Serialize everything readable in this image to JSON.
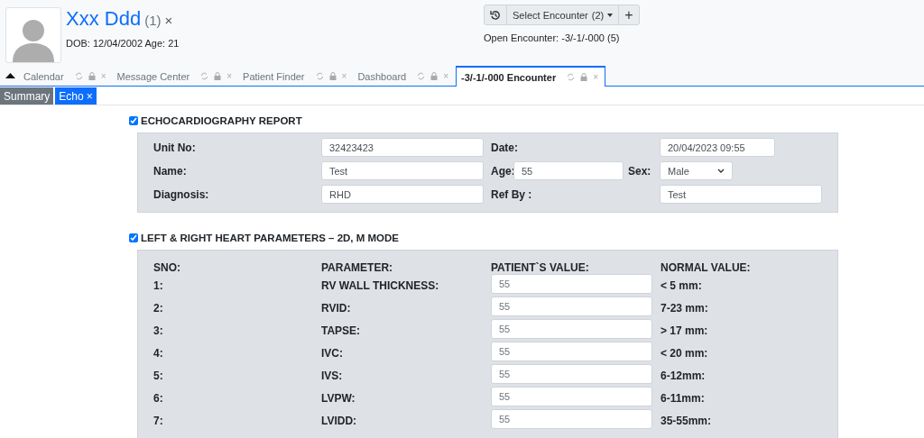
{
  "patient": {
    "name": "Xxx Ddd",
    "count": "(1)",
    "close": "×",
    "info": "DOB: 12/04/2002 Age: 21"
  },
  "encounter": {
    "select_label": "Select Encounter",
    "select_count": "(2)",
    "add": "+",
    "open_text": "Open Encounter: -3/-1/-000 (5)"
  },
  "tabs": [
    {
      "label": "Calendar",
      "selected": false,
      "close": "×"
    },
    {
      "label": "Message Center",
      "selected": false,
      "close": "×"
    },
    {
      "label": "Patient Finder",
      "selected": false,
      "close": "×"
    },
    {
      "label": "Dashboard",
      "selected": false,
      "close": "×"
    },
    {
      "label": "-3/-1/-000 Encounter",
      "selected": true,
      "close": "×"
    }
  ],
  "subtabs": [
    {
      "label": "Summary",
      "selected": false
    },
    {
      "label": "Echo",
      "selected": true,
      "close": "×"
    }
  ],
  "report": {
    "title": "ECHOCARDIOGRAPHY REPORT",
    "checked": true,
    "rows": [
      [
        {
          "label": "Unit No:",
          "value": "32423423"
        },
        {
          "label": "Date:",
          "value": "20/04/2023 09:55"
        }
      ],
      [
        {
          "label": "Name:",
          "value": "Test"
        },
        {
          "label": "Age:",
          "value": "55"
        },
        {
          "label": "Sex:",
          "value": "Male",
          "kind": "select"
        }
      ],
      [
        {
          "label": "Diagnosis:",
          "value": "RHD"
        },
        {
          "label": "Ref By :",
          "value": "Test"
        }
      ]
    ]
  },
  "parameters": {
    "title": "LEFT & RIGHT HEART PARAMETERS – 2D, M MODE",
    "checked": true,
    "columns": [
      "SNO:",
      "PARAMETER:",
      "PATIENT`S VALUE:",
      "NORMAL VALUE:"
    ],
    "rows": [
      {
        "sno": "1:",
        "parameter": "RV WALL THICKNESS:",
        "value": "55",
        "normal": "< 5 mm:"
      },
      {
        "sno": "2:",
        "parameter": "RVID:",
        "value": "55",
        "normal": "7-23 mm:"
      },
      {
        "sno": "3:",
        "parameter": "TAPSE:",
        "value": "55",
        "normal": "> 17 mm:"
      },
      {
        "sno": "4:",
        "parameter": "IVC:",
        "value": "55",
        "normal": "< 20 mm:"
      },
      {
        "sno": "5:",
        "parameter": "IVS:",
        "value": "55",
        "normal": "6-12mm:"
      },
      {
        "sno": "6:",
        "parameter": "LVPW:",
        "value": "55",
        "normal": "6-11mm:"
      },
      {
        "sno": "7:",
        "parameter": "LVIDD:",
        "value": "55",
        "normal": "35-55mm:"
      }
    ]
  }
}
